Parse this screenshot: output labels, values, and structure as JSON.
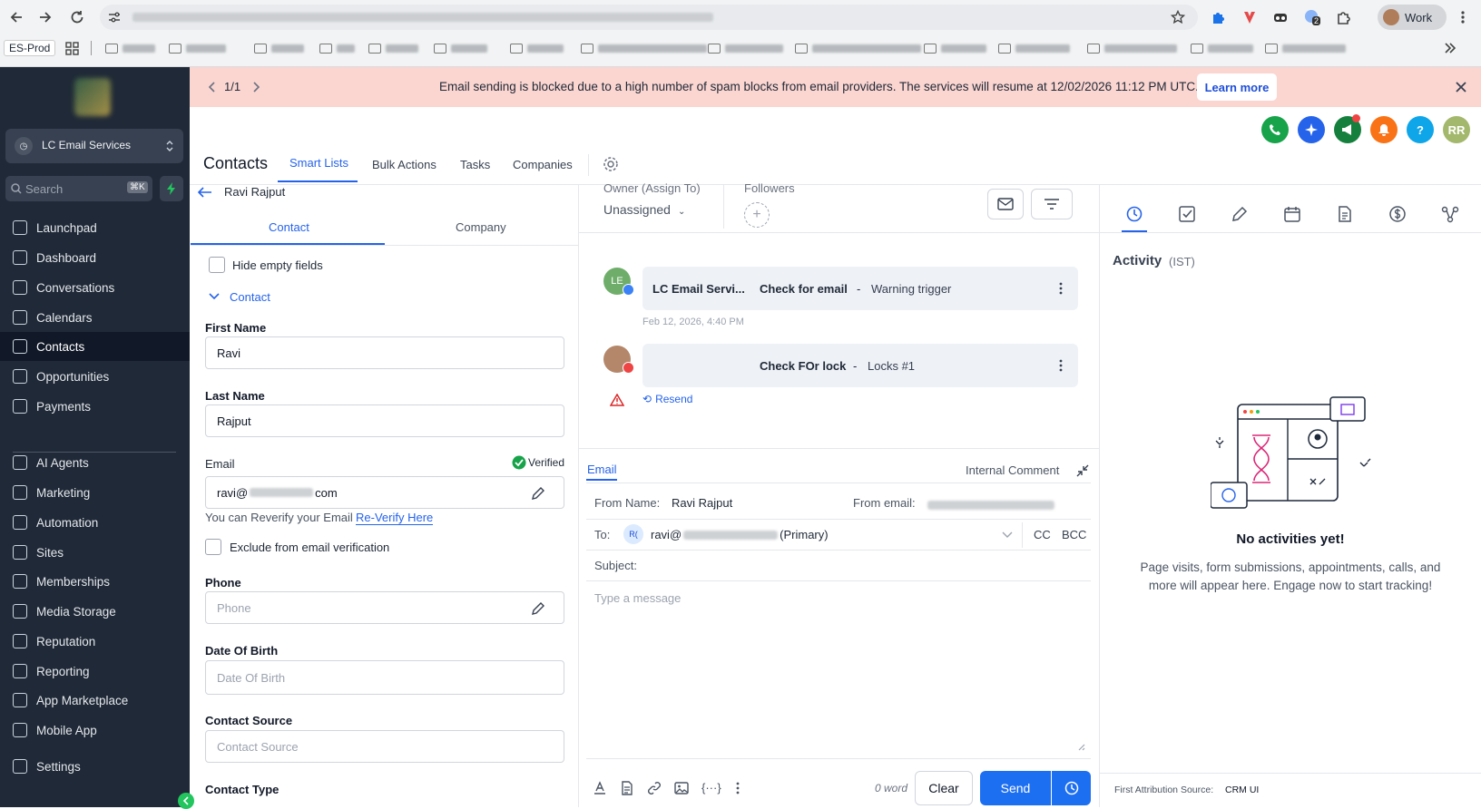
{
  "browser": {
    "es_prod": "ES-Prod",
    "work_label": "Work",
    "ext_badge": "2"
  },
  "sidebar": {
    "location": "LC Email Services",
    "search_placeholder": "Search",
    "search_shortcut": "⌘K",
    "items": [
      {
        "label": "Launchpad",
        "icon": "rocket-icon"
      },
      {
        "label": "Dashboard",
        "icon": "grid-icon"
      },
      {
        "label": "Conversations",
        "icon": "chat-icon"
      },
      {
        "label": "Calendars",
        "icon": "calendar-icon"
      },
      {
        "label": "Contacts",
        "icon": "contacts-icon"
      },
      {
        "label": "Opportunities",
        "icon": "opportunities-icon"
      },
      {
        "label": "Payments",
        "icon": "payments-icon"
      },
      {
        "label": "AI Agents",
        "icon": "sparkle-icon"
      },
      {
        "label": "Marketing",
        "icon": "send-icon"
      },
      {
        "label": "Automation",
        "icon": "automation-icon"
      },
      {
        "label": "Sites",
        "icon": "sites-icon"
      },
      {
        "label": "Memberships",
        "icon": "memberships-icon"
      },
      {
        "label": "Media Storage",
        "icon": "image-icon"
      },
      {
        "label": "Reputation",
        "icon": "star-icon"
      },
      {
        "label": "Reporting",
        "icon": "trend-icon"
      },
      {
        "label": "App Marketplace",
        "icon": "apps-icon"
      },
      {
        "label": "Mobile App",
        "icon": "mobile-icon"
      },
      {
        "label": "Settings",
        "icon": "gear-icon"
      }
    ]
  },
  "banner": {
    "pager": "1/1",
    "message": "Email sending is blocked due to a high number of spam blocks from email providers. The services will resume at 12/02/2026 11:12 PM UTC.",
    "cta": "Learn more"
  },
  "header": {
    "title": "Contacts",
    "tabs": [
      "Smart Lists",
      "Bulk Actions",
      "Tasks",
      "Companies"
    ],
    "avatar_initials": "RR",
    "help": "?"
  },
  "contact_panel": {
    "back_name": "Ravi Rajput",
    "tabs": [
      "Contact",
      "Company"
    ],
    "hide_empty": "Hide empty fields",
    "section": "Contact",
    "first_name_label": "First Name",
    "first_name": "Ravi",
    "last_name_label": "Last Name",
    "last_name": "Rajput",
    "email_label": "Email",
    "verified": "Verified",
    "email_prefix": "ravi@",
    "email_suffix": "com",
    "reverify_text": "You can Reverify your Email",
    "reverify_link": "Re-Verify Here",
    "exclude": "Exclude from email verification",
    "phone_label": "Phone",
    "phone_placeholder": "Phone",
    "dob_label": "Date Of Birth",
    "dob_placeholder": "Date Of Birth",
    "source_label": "Contact Source",
    "source_placeholder": "Contact Source",
    "type_label": "Contact Type"
  },
  "conversation": {
    "owner_label": "Owner (Assign To)",
    "owner_value": "Unassigned",
    "followers_label": "Followers",
    "msg1": {
      "avatar": "LE",
      "sender": "LC Email Servi...",
      "subject": "Check for email",
      "sep": "-",
      "preview": "Warning trigger",
      "time": "Feb 12, 2026, 4:40 PM"
    },
    "msg2": {
      "subject": "Check FOr lock",
      "sep": "-",
      "preview": "Locks #1"
    },
    "resend": "Resend"
  },
  "composer": {
    "tab_email": "Email",
    "tab_comment": "Internal Comment",
    "from_name_label": "From Name:",
    "from_name": "Ravi Rajput",
    "from_email_label": "From email:",
    "to_label": "To:",
    "to_avatar": "R(",
    "to_prefix": "ravi@",
    "to_suffix": "(Primary)",
    "cc": "CC",
    "bcc": "BCC",
    "subject_label": "Subject:",
    "message_placeholder": "Type a message",
    "word_count": "0 word",
    "clear": "Clear",
    "send": "Send"
  },
  "activity": {
    "title": "Activity",
    "tz": "(IST)",
    "empty_title": "No activities yet!",
    "empty_text": "Page visits, form submissions, appointments, calls, and more will appear here. Engage now to start tracking!",
    "attribution_label": "First Attribution Source:",
    "attribution_value": "CRM UI"
  }
}
